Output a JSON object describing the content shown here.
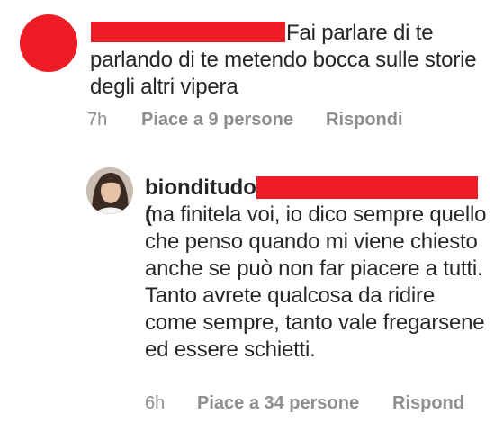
{
  "comment1": {
    "text_lead": "Fai parlare di te",
    "text_rest": "parlando di te metendo bocca sulle storie degli altri vipera",
    "time": "7h",
    "likes": "Piace a 9 persone",
    "reply": "Rispondi"
  },
  "comment2": {
    "username": "bionditudo",
    "username_suffix": " (",
    "text": "ma finitela voi, io dico sempre quello che penso quando mi viene chiesto anche se può non far piacere a tutti. Tanto avrete qualcosa da ridire come sempre, tanto vale fregarsene ed essere schietti.",
    "time": "6h",
    "likes": "Piace a 34 persone",
    "reply": "Rispond"
  },
  "colors": {
    "redaction": "#ee1c24",
    "meta_text": "#8e8e8e",
    "body_text": "#262626"
  }
}
